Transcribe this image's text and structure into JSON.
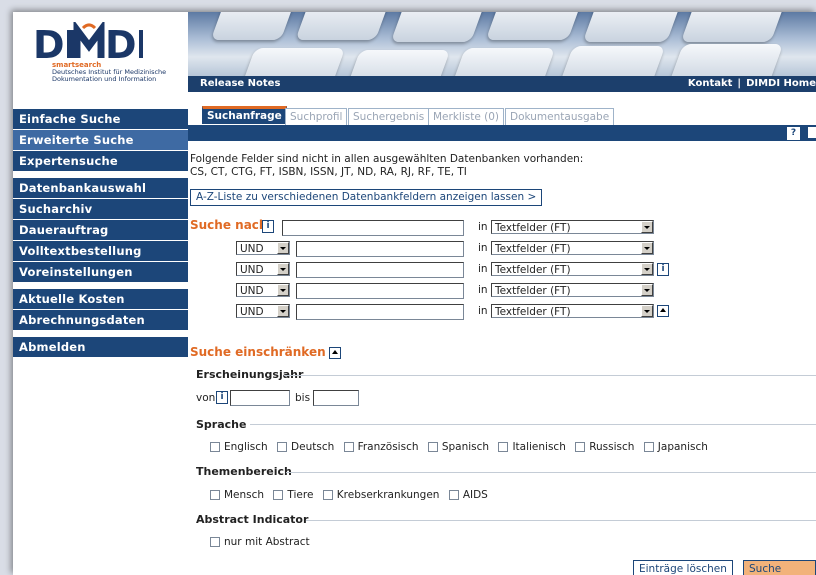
{
  "logo": {
    "text": "DIMDI",
    "smart": "smartsearch",
    "line1": "Deutsches Institut für Medizinische",
    "line2": "Dokumentation und Information"
  },
  "topbar": {
    "release": "Release Notes",
    "kontakt": "Kontakt",
    "sep": "|",
    "home": "DIMDI Home"
  },
  "nav": {
    "items1": [
      "Einfache Suche",
      "Erweiterte Suche",
      "Expertensuche"
    ],
    "items2": [
      "Datenbankauswahl",
      "Sucharchiv",
      "Dauerauftrag",
      "Volltextbestellung",
      "Voreinstellungen"
    ],
    "items3": [
      "Aktuelle Kosten",
      "Abrechnungsdaten"
    ],
    "items4": [
      "Abmelden"
    ]
  },
  "tabs": [
    "Suchanfrage",
    "Suchprofil",
    "Suchergebnis",
    "Merkliste (0)",
    "Dokumentausgabe"
  ],
  "help": "?",
  "notice": {
    "line1": "Folgende Felder sind nicht in allen ausgewählten Datenbanken vorhanden:",
    "line2": "CS, CT, CTG, FT, ISBN, ISSN, JT, ND, RA, RJ, RF, TE, TI"
  },
  "az_button": "A-Z-Liste zu verschiedenen Datenbankfeldern anzeigen lassen >",
  "search": {
    "label": "Suche nach",
    "info": "i",
    "in_label": "in",
    "operator": "UND",
    "field": "Textfelder (FT)"
  },
  "restrict": {
    "label": "Suche einschränken"
  },
  "year": {
    "title": "Erscheinungsjahr",
    "from": "von",
    "to": "bis"
  },
  "language": {
    "title": "Sprache",
    "options": [
      "Englisch",
      "Deutsch",
      "Französisch",
      "Spanisch",
      "Italienisch",
      "Russisch",
      "Japanisch"
    ]
  },
  "topic": {
    "title": "Themenbereich",
    "options": [
      "Mensch",
      "Tiere",
      "Krebserkrankungen",
      "AIDS"
    ]
  },
  "abstract": {
    "title": "Abstract Indicator",
    "option": "nur mit Abstract"
  },
  "buttons": {
    "clear": "Einträge löschen",
    "start": "Suche starten"
  }
}
